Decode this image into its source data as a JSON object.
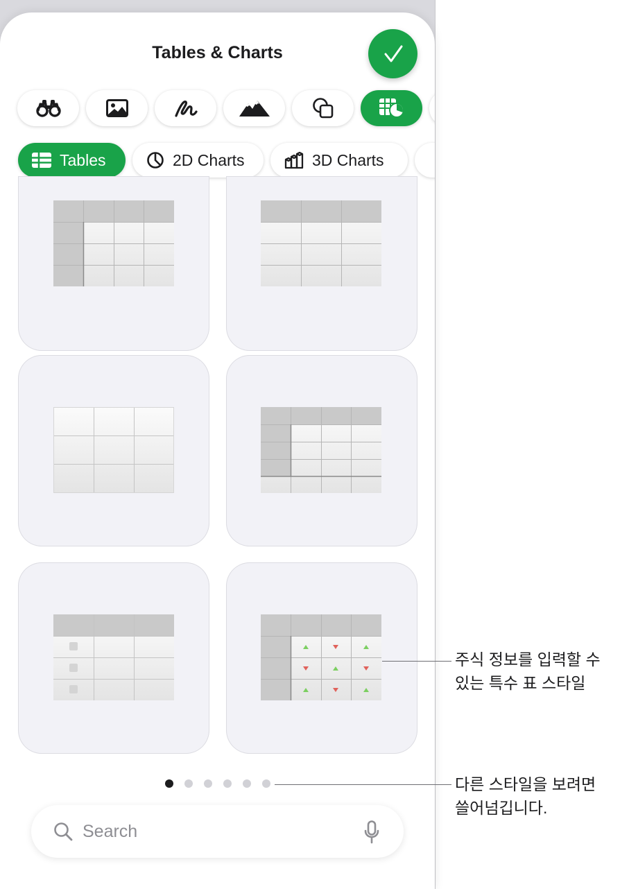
{
  "header": {
    "title": "Tables & Charts"
  },
  "done_icon": "checkmark-icon",
  "icon_tabs": [
    {
      "icon": "binoculars-icon"
    },
    {
      "icon": "photo-icon"
    },
    {
      "icon": "drawing-icon"
    },
    {
      "icon": "mountains-icon"
    },
    {
      "icon": "shapes-icon"
    },
    {
      "icon": "table-chart-icon",
      "selected": true
    }
  ],
  "chips": [
    {
      "icon": "table-icon",
      "label": "Tables",
      "selected": true
    },
    {
      "icon": "pie-chart-icon",
      "label": "2D Charts"
    },
    {
      "icon": "bar-3d-icon",
      "label": "3D Charts"
    }
  ],
  "pagination": {
    "count": 6,
    "active": 0
  },
  "search": {
    "placeholder": "Search",
    "icon": "magnifier-icon",
    "mic_icon": "microphone-icon"
  },
  "callouts": [
    {
      "text": "주식 정보를 입력할 수\n있는 특수 표 스타일"
    },
    {
      "text": "다른 스타일을 보려면\n쓸어넘깁니다."
    }
  ],
  "colors": {
    "accent": "#19a349",
    "up_arrow": "#7ccf61",
    "down_arrow": "#e0625b"
  }
}
